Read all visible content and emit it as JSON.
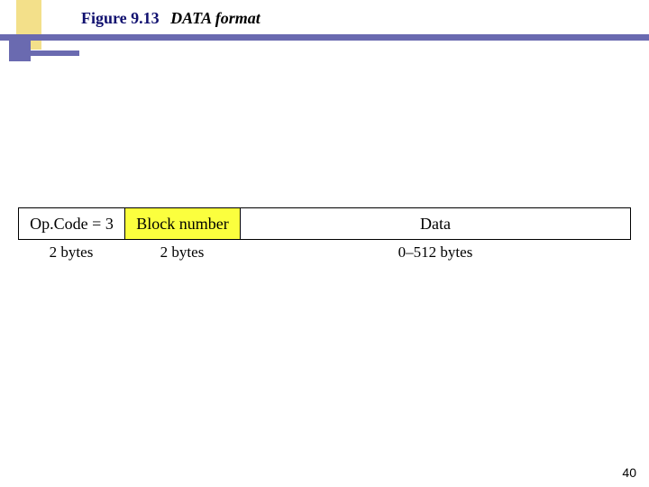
{
  "title": {
    "figure_number": "Figure 9.13",
    "figure_name": "DATA format"
  },
  "packet": {
    "fields": {
      "opcode": {
        "label": "Op.Code = 3",
        "size": "2 bytes",
        "bg": "#ffffff"
      },
      "block": {
        "label": "Block number",
        "size": "2 bytes",
        "bg": "#fbff3e"
      },
      "data": {
        "label": "Data",
        "size": "0–512 bytes",
        "bg": "#ffffff"
      }
    }
  },
  "page_number": "40"
}
